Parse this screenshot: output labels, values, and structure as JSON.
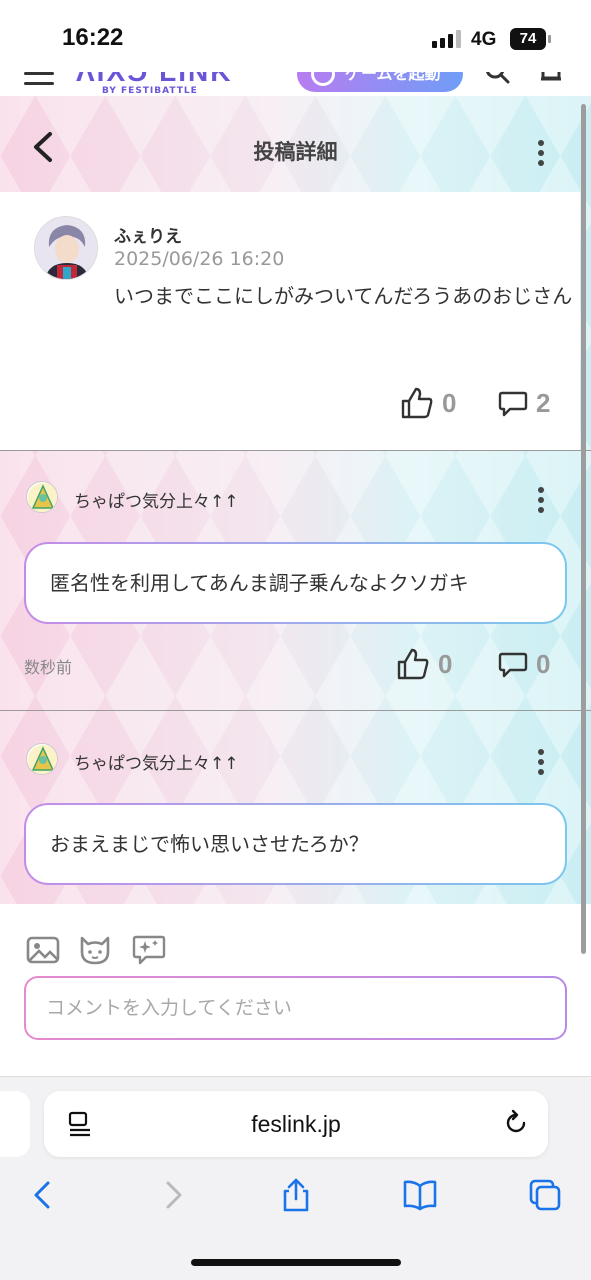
{
  "status_bar": {
    "time": "16:22",
    "network": "4G",
    "battery": "74"
  },
  "site_header": {
    "logo": "ɅIXƆ LINK",
    "logo_sub": "BY FESTIBATTLE",
    "game_button": "ゲームを起動"
  },
  "page": {
    "title": "投稿詳細"
  },
  "post": {
    "author": "ふぇりえ",
    "date": "2025/06/26 16:20",
    "body": "いつまでここにしがみついてんだろうあのおじさん",
    "likes": "0",
    "comments": "2"
  },
  "comments": [
    {
      "author": "ちゃぱつ気分上々↑↑",
      "text": "匿名性を利用してあんま調子乗んなよクソガキ",
      "time": "数秒前",
      "likes": "0",
      "replies": "0"
    },
    {
      "author": "ちゃぱつ気分上々↑↑",
      "text": "おまえまじで怖い思いさせたろか？"
    }
  ],
  "comment_input": {
    "placeholder": "コメントを入力してください"
  },
  "browser": {
    "url": "feslink.jp"
  },
  "colors": {
    "accent_purple": "#b77cf0",
    "accent_blue": "#6f9ef7",
    "ios_blue": "#1a73e8"
  }
}
